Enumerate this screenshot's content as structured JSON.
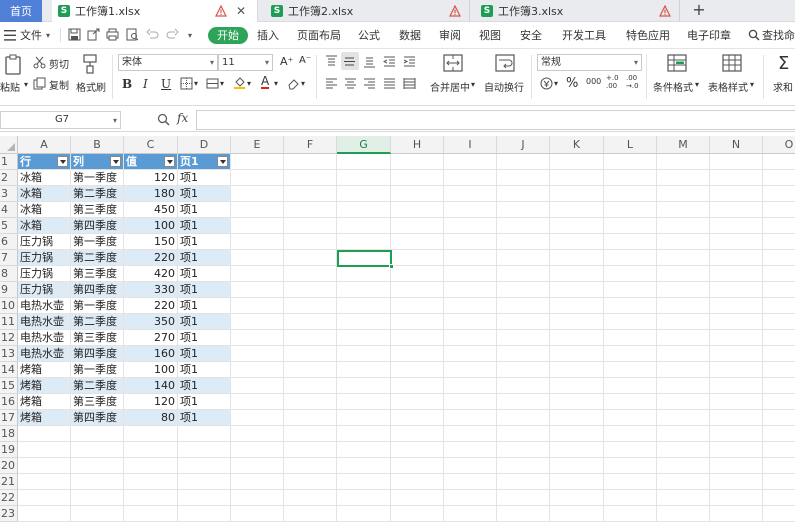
{
  "tabs": {
    "home": "首页",
    "files": [
      {
        "name": "工作簿1.xlsx",
        "active": true
      },
      {
        "name": "工作簿2.xlsx",
        "active": false
      },
      {
        "name": "工作簿3.xlsx",
        "active": false
      }
    ],
    "add": "+",
    "close": "✕",
    "s_glyph": "S"
  },
  "menu": {
    "file": "文件",
    "items": [
      "开始",
      "插入",
      "页面布局",
      "公式",
      "数据",
      "审阅",
      "视图",
      "安全",
      "开发工具",
      "特色应用",
      "电子印章"
    ],
    "active": "开始",
    "search": "查找命令"
  },
  "ribbon": {
    "paste": "粘贴",
    "cut": "剪切",
    "copy": "复制",
    "format_painter": "格式刷",
    "font_name": "宋体",
    "font_size": "11",
    "bold": "B",
    "italic": "I",
    "underline": "U",
    "font_color_glyph": "A",
    "grow_font": "A⁺",
    "shrink_font": "A⁻",
    "merge_center": "合并居中",
    "wrap_text": "自动换行",
    "number_format": "常规",
    "percent": "%",
    "thousands": "000",
    "inc_decimal": "+.0\n.00",
    "dec_decimal": ".00\n→.0",
    "cond_format": "条件格式",
    "table_style": "表格样式",
    "sum": "求和"
  },
  "formula_bar": {
    "cell_ref": "G7",
    "fx": "fx",
    "value": ""
  },
  "sheet": {
    "columns": [
      "A",
      "B",
      "C",
      "D",
      "E",
      "F",
      "G",
      "H",
      "I",
      "J",
      "K",
      "L",
      "M",
      "N",
      "O"
    ],
    "selected_column": "G",
    "selected_cell": "G7",
    "row_numbers": [
      "1",
      "2",
      "3",
      "4",
      "5",
      "6",
      "7",
      "8",
      "9",
      "10",
      "11",
      "12",
      "13",
      "14",
      "15",
      "16",
      "17",
      "18",
      "19",
      "20",
      "21",
      "22",
      "23"
    ],
    "header": [
      "行",
      "列",
      "值",
      "页1"
    ],
    "rows": [
      [
        "冰箱",
        "第一季度",
        "120",
        "项1"
      ],
      [
        "冰箱",
        "第二季度",
        "180",
        "项1"
      ],
      [
        "冰箱",
        "第三季度",
        "450",
        "项1"
      ],
      [
        "冰箱",
        "第四季度",
        "100",
        "项1"
      ],
      [
        "压力锅",
        "第一季度",
        "150",
        "项1"
      ],
      [
        "压力锅",
        "第二季度",
        "220",
        "项1"
      ],
      [
        "压力锅",
        "第三季度",
        "420",
        "项1"
      ],
      [
        "压力锅",
        "第四季度",
        "330",
        "项1"
      ],
      [
        "电热水壶",
        "第一季度",
        "220",
        "项1"
      ],
      [
        "电热水壶",
        "第二季度",
        "350",
        "项1"
      ],
      [
        "电热水壶",
        "第三季度",
        "270",
        "项1"
      ],
      [
        "电热水壶",
        "第四季度",
        "160",
        "项1"
      ],
      [
        "烤箱",
        "第一季度",
        "100",
        "项1"
      ],
      [
        "烤箱",
        "第二季度",
        "140",
        "项1"
      ],
      [
        "烤箱",
        "第三季度",
        "120",
        "项1"
      ],
      [
        "烤箱",
        "第四季度",
        "80",
        "项1"
      ]
    ]
  },
  "colors": {
    "accent": "#1e9e55",
    "table_header": "#5b9bd5",
    "table_band": "#ddebf7",
    "home_tab": "#4f7fd6"
  }
}
